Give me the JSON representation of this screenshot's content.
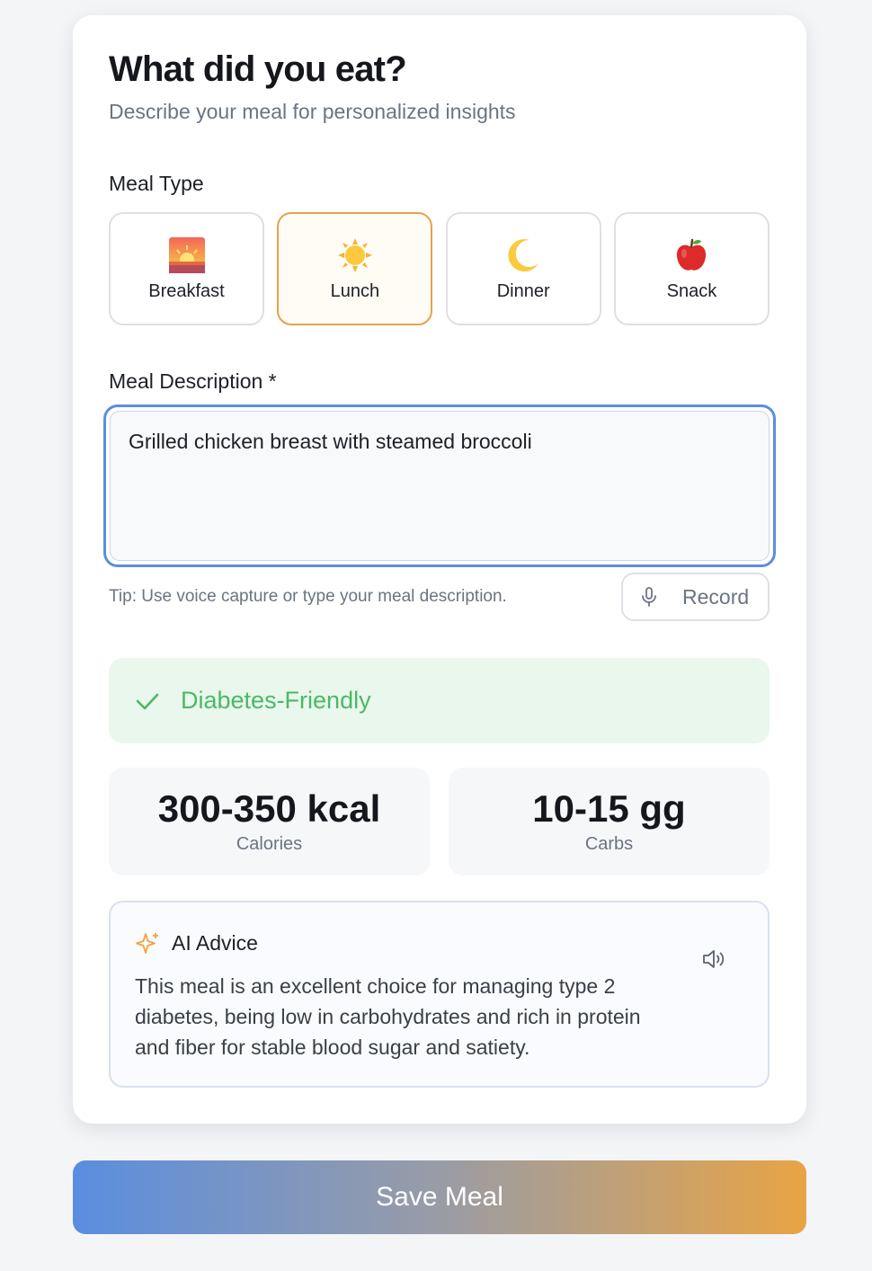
{
  "header": {
    "title": "What did you eat?",
    "subtitle": "Describe your meal for personalized insights"
  },
  "meal_type": {
    "label": "Meal Type",
    "options": [
      {
        "label": "Breakfast",
        "icon": "sunrise-icon",
        "selected": false
      },
      {
        "label": "Lunch",
        "icon": "sun-icon",
        "selected": true
      },
      {
        "label": "Dinner",
        "icon": "crescent-moon-icon",
        "selected": false
      },
      {
        "label": "Snack",
        "icon": "apple-icon",
        "selected": false
      }
    ]
  },
  "description": {
    "label": "Meal Description *",
    "value": "Grilled chicken breast with steamed broccoli",
    "tip": "Tip: Use voice capture or type your meal description.",
    "record_label": "Record"
  },
  "status": {
    "label": "Diabetes-Friendly",
    "color": "#4cb866"
  },
  "stats": {
    "calories": {
      "value": "300-350 kcal",
      "label": "Calories"
    },
    "carbs": {
      "value": "10-15 gg",
      "label": "Carbs"
    }
  },
  "advice": {
    "title": "AI Advice",
    "text": "This meal is an excellent choice for managing type 2 diabetes, being low in carbohydrates and rich in protein and fiber for stable blood sugar and satiety."
  },
  "save_button": {
    "label": "Save Meal"
  },
  "colors": {
    "accent_blue": "#5a8ee0",
    "accent_orange": "#e8a445",
    "selected_border": "#e7a24c"
  }
}
